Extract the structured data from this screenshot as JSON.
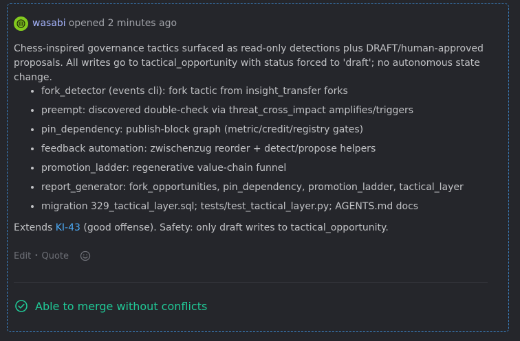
{
  "comment": {
    "author": "wasabi",
    "opened_text": "opened 2 minutes ago",
    "description": "Chess-inspired governance tactics surfaced as read-only detections plus DRAFT/human-approved proposals. All writes go to tactical_opportunity with status forced to 'draft'; no autonomous state change.",
    "items": [
      "fork_detector (events cli): fork tactic from insight_transfer forks",
      "preempt: discovered double-check via threat_cross_impact amplifies/triggers",
      "pin_dependency: publish-block graph (metric/credit/registry gates)",
      "feedback automation: zwischenzug reorder + detect/propose helpers",
      "promotion_ladder: regenerative value-chain funnel",
      "report_generator: fork_opportunities, pin_dependency, promotion_ladder, tactical_layer",
      "migration 329_tactical_layer.sql; tests/test_tactical_layer.py; AGENTS.md docs"
    ],
    "extends_prefix": "Extends",
    "extends_link": "KI-43",
    "extends_suffix": "(good offense). Safety: only draft writes to tactical_opportunity.",
    "actions": {
      "edit": "Edit",
      "separator": "•",
      "quote": "Quote"
    }
  },
  "merge_status": "Able to merge without conflicts",
  "colors": {
    "accent_link": "#4dabf7",
    "author": "#a5b4fc",
    "success": "#20c997",
    "avatar": "#82c91e",
    "border": "#3b82c4"
  },
  "icons": {
    "avatar": "avatar-icon",
    "emoji": "smiley-icon",
    "merge": "check-circle-icon"
  }
}
